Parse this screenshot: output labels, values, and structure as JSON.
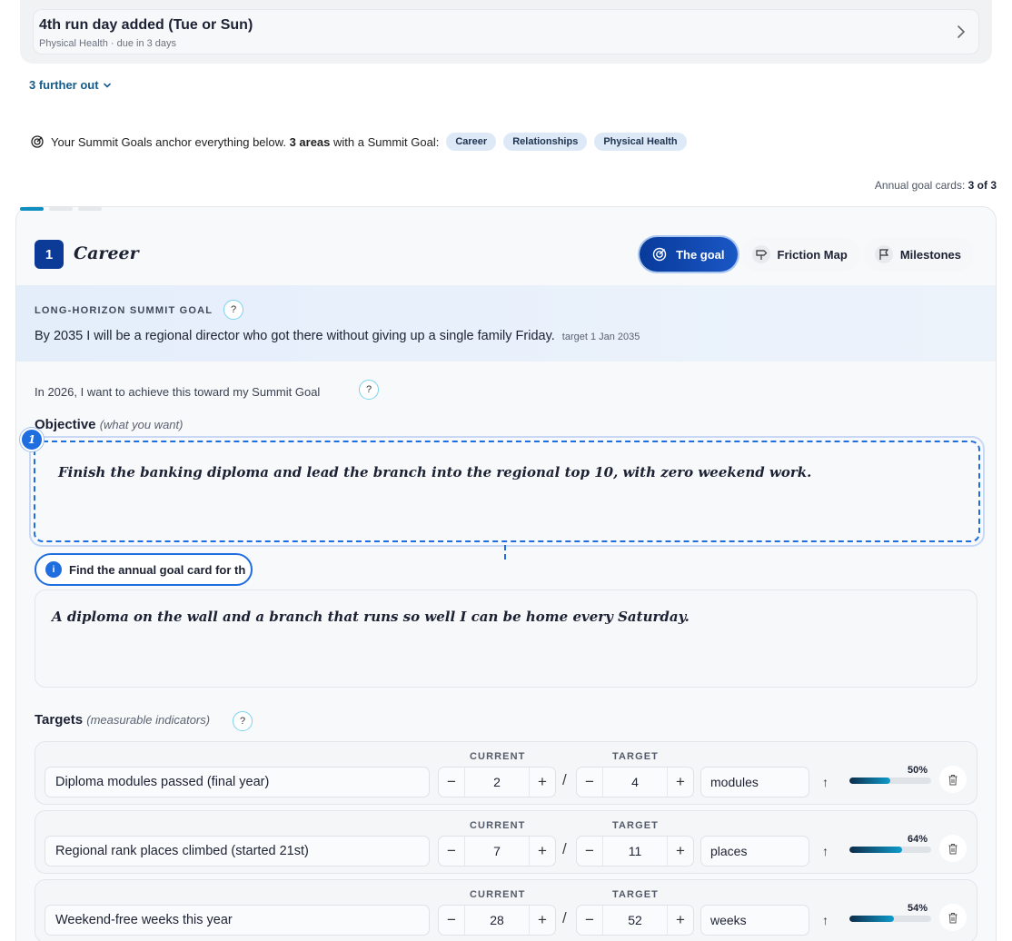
{
  "upcoming": {
    "item_title": "4th run day added (Tue or Sun)",
    "item_sub": "Physical Health · due in 3 days",
    "further_label": "3 further out"
  },
  "summit_banner": {
    "prefix": "Your Summit Goals anchor everything below.",
    "count_text": "3 areas",
    "suffix": "with a Summit Goal:",
    "chips": [
      "Career",
      "Relationships",
      "Physical Health"
    ]
  },
  "annual": {
    "label": "Annual goal cards:",
    "count": "3 of 3"
  },
  "card": {
    "number": "1",
    "title": "Career",
    "tabs": [
      {
        "label": "The goal",
        "active": true
      },
      {
        "label": "Friction Map",
        "active": false
      },
      {
        "label": "Milestones",
        "active": false
      }
    ],
    "summit_label": "LONG-HORIZON SUMMIT GOAL",
    "summit_text": "By 2035 I will be a regional director who got there without giving up a single family Friday.",
    "summit_target": "target 1 Jan 2035",
    "intro": "In 2026, I want to achieve this toward my Summit Goal",
    "objective_label": "Objective",
    "objective_hint": "(what you want)",
    "objective_text": "Finish the banking diploma and lead the branch into the regional top 10, with zero weekend work.",
    "step_number": "1",
    "guide_pill": "Find the annual goal card for th",
    "why_text": "A diploma on the wall and a branch that runs so well I can be home every Saturday.",
    "targets_label": "Targets",
    "targets_hint": "(measurable indicators)",
    "current_head": "CURRENT",
    "target_head": "TARGET",
    "minus": "−",
    "plus": "+",
    "slash": "/",
    "arrow": "↑",
    "targets": [
      {
        "name": "Diploma modules passed (final year)",
        "current": "2",
        "target": "4",
        "unit": "modules",
        "pct": "50%",
        "progress": 0.5
      },
      {
        "name": "Regional rank places climbed (started 21st)",
        "current": "7",
        "target": "11",
        "unit": "places",
        "pct": "64%",
        "progress": 0.64
      },
      {
        "name": "Weekend-free weeks this year",
        "current": "28",
        "target": "52",
        "unit": "weeks",
        "pct": "54%",
        "progress": 0.54
      }
    ]
  },
  "colors": {
    "accent": "#1f6ee0",
    "navy": "#0b3b97",
    "teal": "#0e9ccc"
  }
}
